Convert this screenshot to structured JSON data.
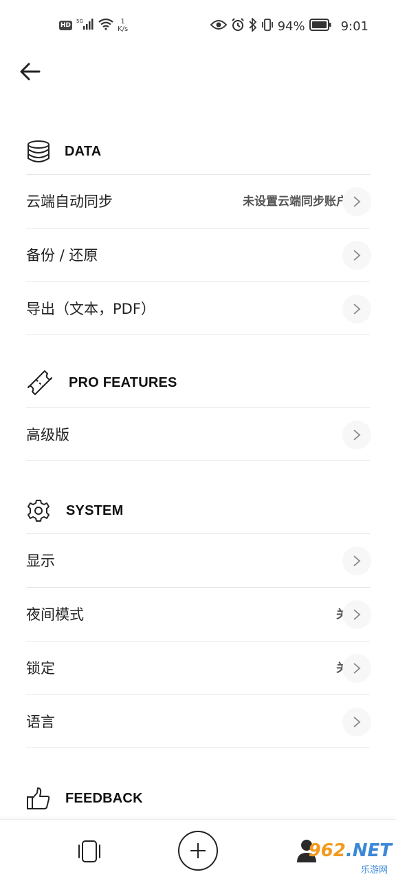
{
  "status_bar": {
    "hd": "HD",
    "signal_type": "5G",
    "net_speed_value": "1",
    "net_speed_unit": "K/s",
    "battery": "94%",
    "time": "9:01"
  },
  "sections": {
    "data": {
      "title": "DATA",
      "rows": [
        {
          "label": "云端自动同步",
          "value": "未设置云端同步账户"
        },
        {
          "label": "备份 / 还原"
        },
        {
          "label": "导出（文本，PDF）"
        }
      ]
    },
    "pro": {
      "title": "PRO FEATURES",
      "rows": [
        {
          "label": "高级版"
        }
      ]
    },
    "system": {
      "title": "SYSTEM",
      "rows": [
        {
          "label": "显示"
        },
        {
          "label": "夜间模式",
          "value": "关"
        },
        {
          "label": "锁定",
          "value": "关"
        },
        {
          "label": "语言"
        }
      ]
    },
    "feedback": {
      "title": "FEEDBACK"
    }
  },
  "watermark": {
    "brand": "962",
    "suffix": ".NET",
    "sub": "乐游网"
  },
  "icons": {
    "back": "arrow-left-icon",
    "data": "database-icon",
    "pro": "ticket-icon",
    "system": "gear-icon",
    "feedback": "thumbs-up-icon",
    "chevron": "chevron-right-icon",
    "bottom_left": "phone-frame-icon",
    "bottom_center": "plus-icon",
    "bottom_right": "user-icon"
  }
}
